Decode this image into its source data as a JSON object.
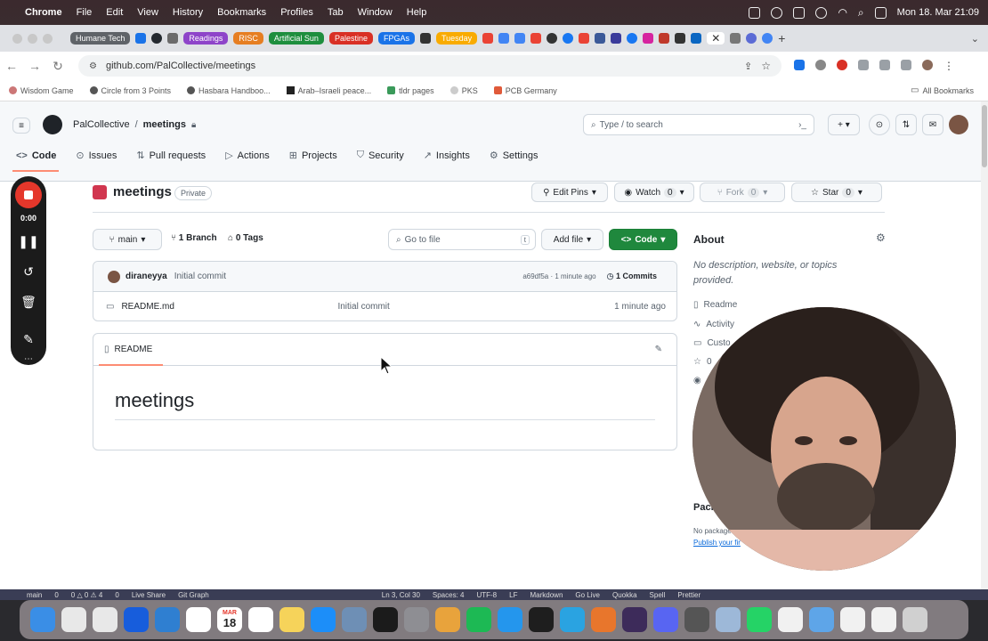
{
  "menubar": {
    "apple": "",
    "items": [
      "Chrome",
      "File",
      "Edit",
      "View",
      "History",
      "Bookmarks",
      "Profiles",
      "Tab",
      "Window",
      "Help"
    ],
    "clock": "Mon 18. Mar  21:09"
  },
  "tabs": {
    "pills": [
      {
        "label": "Humane Tech",
        "color": "#5f6368"
      },
      {
        "label": "Readings",
        "color": "#8e44c9"
      },
      {
        "label": "RISC",
        "color": "#e67e22"
      },
      {
        "label": "Artificial Sun",
        "color": "#1e8e3e"
      },
      {
        "label": "Palestine",
        "color": "#d93025"
      },
      {
        "label": "FPGAs",
        "color": "#1a73e8"
      },
      {
        "label": "Tuesday",
        "color": "#f9ab00"
      }
    ],
    "new_tab": "+"
  },
  "address": {
    "url": "github.com/PalCollective/meetings"
  },
  "bookmarks": {
    "items": [
      "Wisdom Game",
      "Circle from 3 Points",
      "Hasbara Handboo...",
      "Arab–Israeli peace...",
      "tldr pages",
      "PKS",
      "PCB Germany"
    ],
    "all": "All Bookmarks"
  },
  "github": {
    "owner": "PalCollective",
    "sep": "/",
    "repo": "meetings",
    "search_placeholder": "Type / to search",
    "nav": [
      "Code",
      "Issues",
      "Pull requests",
      "Actions",
      "Projects",
      "Security",
      "Insights",
      "Settings"
    ],
    "repo_title": "meetings",
    "visibility": "Private",
    "edit_pins": "Edit Pins",
    "watch": "Watch",
    "watch_count": "0",
    "fork": "Fork",
    "fork_count": "0",
    "star": "Star",
    "star_count": "0",
    "branch": "main",
    "branches": "1 Branch",
    "tags": "0 Tags",
    "go_to_file": "Go to file",
    "go_to_file_key": "t",
    "add_file": "Add file",
    "code_button": "Code",
    "commit": {
      "author": "diraneyya",
      "message": "Initial commit",
      "meta": "a69df5a · 1 minute ago",
      "commits": "1 Commits"
    },
    "files": [
      {
        "name": "README.md",
        "message": "Initial commit",
        "age": "1 minute ago"
      }
    ],
    "readme_tab": "README",
    "readme_heading": "meetings",
    "about": {
      "title": "About",
      "description": "No description, website, or topics provided.",
      "links": [
        "Readme",
        "Activity",
        "Custo",
        "0",
        "",
        "",
        ""
      ]
    },
    "packages": {
      "title": "Pack",
      "none": "No package",
      "publish": "Publish your fir"
    }
  },
  "recorder": {
    "time": "0:00"
  },
  "statusbar": {
    "items": [
      "main",
      "0",
      "0 △ 0  ⚠ 4",
      "0",
      "Live Share",
      "Git Graph",
      "Ln 3, Col 30",
      "Spaces: 4",
      "UTF-8",
      "LF",
      "Markdown",
      "Go Live",
      "Quokka",
      "Spell",
      "Prettier"
    ]
  },
  "dock": {
    "apps": [
      {
        "name": "Finder",
        "color": "#3a8ee6"
      },
      {
        "name": "Launchpad",
        "color": "#e8e8e8"
      },
      {
        "name": "Chrome",
        "color": "#e8e8e8"
      },
      {
        "name": "Bitwarden",
        "color": "#175ddc"
      },
      {
        "name": "VS Code",
        "color": "#2f7fd1"
      },
      {
        "name": "Slack",
        "color": "#ffffff"
      },
      {
        "name": "Calendar",
        "color": "#ffffff"
      },
      {
        "name": "Reminders",
        "color": "#ffffff"
      },
      {
        "name": "Notes",
        "color": "#f6d35a"
      },
      {
        "name": "App Store",
        "color": "#1c8ef9"
      },
      {
        "name": "Safari",
        "color": "#6e8fb5"
      },
      {
        "name": "Terminal",
        "color": "#1b1b1b"
      },
      {
        "name": "Settings",
        "color": "#8e8e93"
      },
      {
        "name": "Pages",
        "color": "#e8a33c"
      },
      {
        "name": "Spotify",
        "color": "#1db954"
      },
      {
        "name": "Docker",
        "color": "#2496ed"
      },
      {
        "name": "Figma",
        "color": "#1e1e1e"
      },
      {
        "name": "Telegram",
        "color": "#2aa3e1"
      },
      {
        "name": "Keynote",
        "color": "#e8762c"
      },
      {
        "name": "OBS",
        "color": "#3d2b5a"
      },
      {
        "name": "Discord",
        "color": "#5865f2"
      },
      {
        "name": "Calculator",
        "color": "#555555"
      },
      {
        "name": "Preview",
        "color": "#9db8d8"
      },
      {
        "name": "WhatsApp",
        "color": "#25d366"
      },
      {
        "name": "TextEdit",
        "color": "#f1f1f1"
      },
      {
        "name": "Downloads",
        "color": "#5ea5e8"
      },
      {
        "name": "Folder",
        "color": "#f1f1f1"
      },
      {
        "name": "Folder 2",
        "color": "#f1f1f1"
      },
      {
        "name": "Trash",
        "color": "#d0d0d0"
      }
    ],
    "calendar_day": "18",
    "calendar_month": "MAR"
  }
}
